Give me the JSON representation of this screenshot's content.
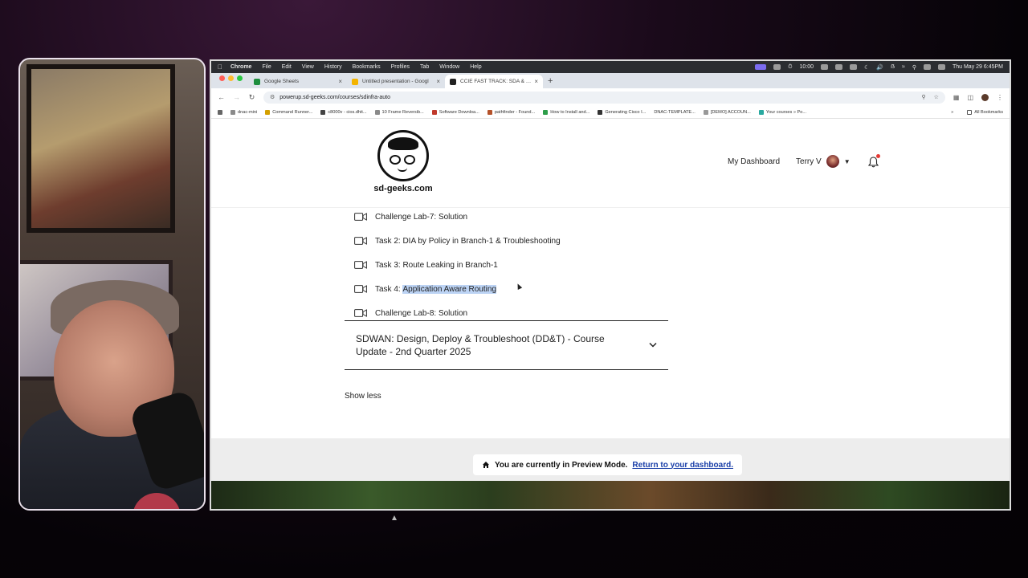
{
  "menubar": {
    "items": [
      "Chrome",
      "File",
      "Edit",
      "View",
      "History",
      "Bookmarks",
      "Profiles",
      "Tab",
      "Window",
      "Help"
    ],
    "timer": "10:00",
    "datetime": "Thu May 29  6:45PM"
  },
  "tabs": [
    {
      "title": "Google Sheets",
      "color": "#1e8e3e"
    },
    {
      "title": "Untitled presentation - Googl",
      "color": "#f4b400"
    },
    {
      "title": "CCIE FAST TRACK: SDA & SD",
      "color": "#222222"
    }
  ],
  "address": {
    "url": "powerup.sd-geeks.com/courses/sdinfra-auto"
  },
  "bookmarks": [
    "dnac-mini",
    "Command Runner...",
    "c8000v - cios.dhit...",
    "10 Frame Reversib...",
    "Software Downloa...",
    "pathfinder - Found...",
    "How to Install and...",
    "Generating Cisco I...",
    "DNAC-TEMPLATE...",
    "[DEMO] ACCOUN...",
    "Your courses » Po..."
  ],
  "all_bookmarks": "All Bookmarks",
  "site": {
    "logo_text": "sd-geeks.com",
    "nav_dashboard": "My Dashboard",
    "user_name": "Terry V"
  },
  "lessons": [
    {
      "prefix": "Challenge Lab-7: Solution",
      "highlight": ""
    },
    {
      "prefix": "Task 2: DIA by Policy in Branch-1 & Troubleshooting",
      "highlight": ""
    },
    {
      "prefix": "Task 3: Route Leaking in Branch-1",
      "highlight": ""
    },
    {
      "prefix": "Task 4: ",
      "highlight": "Application Aware Routing"
    },
    {
      "prefix": "Challenge Lab-8: Solution",
      "highlight": ""
    }
  ],
  "section": {
    "title": "SDWAN: Design, Deploy & Troubleshoot (DD&T) - Course Update - 2nd Quarter 2025"
  },
  "show_less": "Show less",
  "preview": {
    "message": "You are currently in Preview Mode.",
    "link": "Return to your dashboard."
  },
  "colors": {
    "accent_link": "#1a3fa8",
    "highlight": "#bcd3f4",
    "notification": "#e53935"
  }
}
